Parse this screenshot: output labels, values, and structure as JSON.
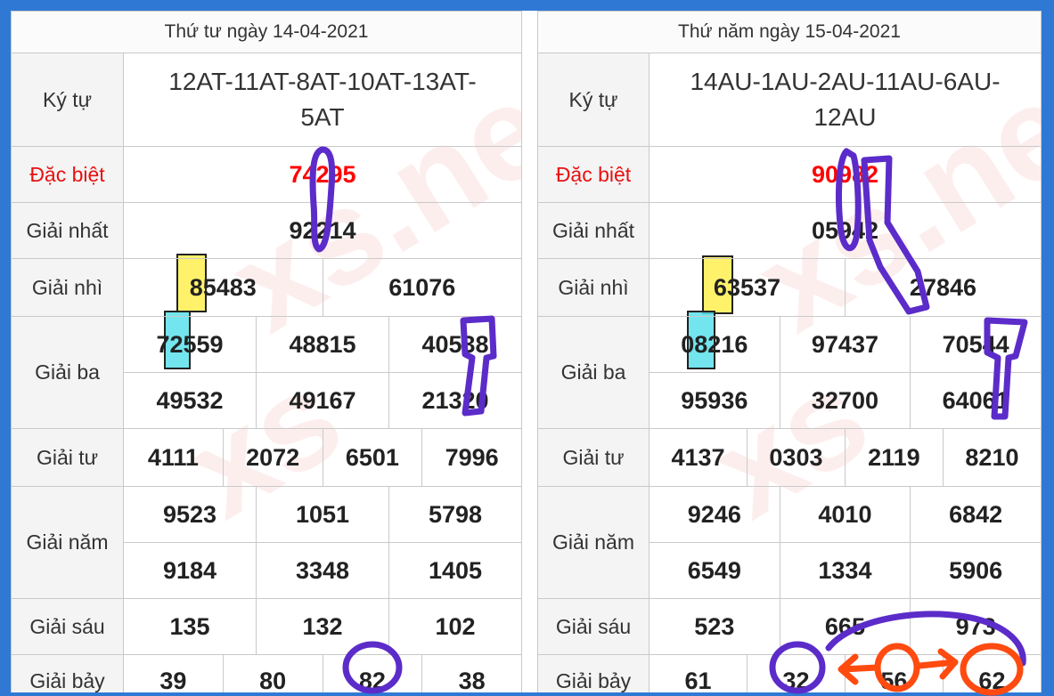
{
  "colors": {
    "frame": "#2f79d4",
    "special_prize": "#ff0000",
    "pen_purple": "#5b2cc9",
    "pen_orange": "#ff4a10",
    "highlight_yellow": "#fff050",
    "highlight_cyan": "#5ae1eb"
  },
  "left": {
    "date": "Thứ tư ngày 14-04-2021",
    "labels": {
      "kytu": "Ký tự",
      "db": "Đặc biệt",
      "g1": "Giải nhất",
      "g2": "Giải nhì",
      "g3": "Giải ba",
      "g4": "Giải tư",
      "g5": "Giải năm",
      "g6": "Giải sáu",
      "g7": "Giải bảy"
    },
    "kytu_line1": "12AT-11AT-8AT-10AT-13AT-",
    "kytu_line2": "5AT",
    "db": "74295",
    "g1": "92214",
    "g2": [
      "85483",
      "61076"
    ],
    "g3": [
      "72559",
      "48815",
      "40538",
      "49532",
      "49167",
      "21320"
    ],
    "g4": [
      "4111",
      "2072",
      "6501",
      "7996"
    ],
    "g5": [
      "9523",
      "1051",
      "5798",
      "9184",
      "3348",
      "1405"
    ],
    "g6": [
      "135",
      "132",
      "102"
    ],
    "g7": [
      "39",
      "80",
      "82",
      "38"
    ]
  },
  "right": {
    "date": "Thứ năm ngày 15-04-2021",
    "labels": {
      "kytu": "Ký tự",
      "db": "Đặc biệt",
      "g1": "Giải nhất",
      "g2": "Giải nhì",
      "g3": "Giải ba",
      "g4": "Giải tư",
      "g5": "Giải năm",
      "g6": "Giải sáu",
      "g7": "Giải bảy"
    },
    "kytu_line1": "14AU-1AU-2AU-11AU-6AU-",
    "kytu_line2": "12AU",
    "db": "90982",
    "g1": "05942",
    "g2": [
      "63537",
      "27846"
    ],
    "g3": [
      "08216",
      "97437",
      "70544",
      "95936",
      "32700",
      "64061"
    ],
    "g4": [
      "4137",
      "0303",
      "2119",
      "8210"
    ],
    "g5": [
      "9246",
      "4010",
      "6842",
      "6549",
      "1334",
      "5906"
    ],
    "g6": [
      "523",
      "665",
      "973"
    ],
    "g7": [
      "61",
      "32",
      "56",
      "62"
    ]
  }
}
